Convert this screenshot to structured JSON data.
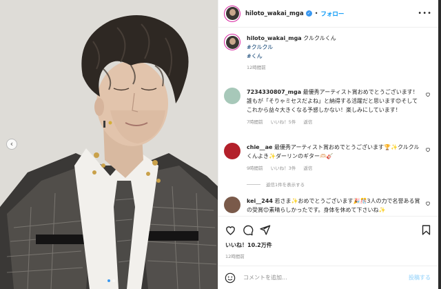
{
  "post": {
    "username": "hiloto_wakai_mga",
    "follow_label": "フォロー",
    "more_icon": "more-horizontal-icon",
    "caption_text": "クルクルくん",
    "hashtags": [
      "#クルクル",
      "#くん"
    ],
    "caption_time": "12時間前"
  },
  "comments": [
    {
      "username": "7234330807_mga",
      "text": "最優秀アーティスト賞おめでとうございます！誰もが「そりゃミセスだよね」と納得する活躍だと思います😊そしてこれから益々大きくなる予感しかない！楽しみにしています！",
      "time": "7時間前",
      "likes": "いいね！5件",
      "reply": "返信",
      "avatar_color": "#a7c8b9"
    },
    {
      "username": "chie__ae",
      "text": "最優秀アーティスト賞おめでとうございます🏆✨クルクルくんよき✨ダーリンのギター🫶🏻🎸",
      "time": "9時間前",
      "likes": "いいね！3件",
      "reply": "返信",
      "view_replies": "返信1件を表示する",
      "avatar_color": "#b3202a"
    },
    {
      "username": "kei__244",
      "text": "若さま✨おめでとうございます🎉🎊3人の力で名誉ある賞の受賞😊素晴らしかったです。身体を休めて下さいね✨",
      "avatar_color": "#7a5a4a"
    }
  ],
  "actions": {
    "like_icon": "heart-icon",
    "comment_icon": "comment-icon",
    "share_icon": "share-icon",
    "save_icon": "bookmark-icon",
    "likes_count": "いいね！10.2万件",
    "post_time": "12時間前"
  },
  "composer": {
    "emoji_icon": "emoji-icon",
    "placeholder": "コメントを追加...",
    "post_label": "投稿する"
  },
  "colors": {
    "accent": "#0095f6",
    "link": "#00376b",
    "muted": "#8e8e8e"
  }
}
